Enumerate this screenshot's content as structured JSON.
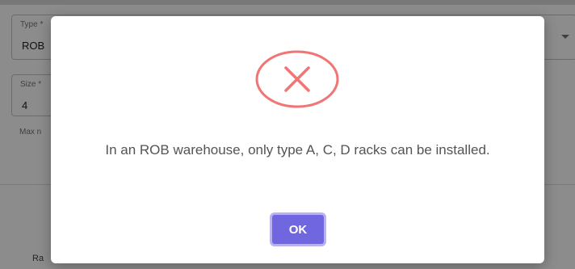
{
  "form": {
    "type_label": "Type *",
    "type_value": "ROB",
    "size_label": "Size *",
    "size_value": "4",
    "helper_text": "Max n",
    "bottom_label": "Ra"
  },
  "dialog": {
    "icon": "error-x-icon",
    "message": "In an ROB warehouse, only type A, C, D racks can be installed.",
    "ok_label": "OK"
  },
  "colors": {
    "error_icon": "#f27474",
    "ok_button": "#7066e0",
    "message_text": "#545454"
  }
}
